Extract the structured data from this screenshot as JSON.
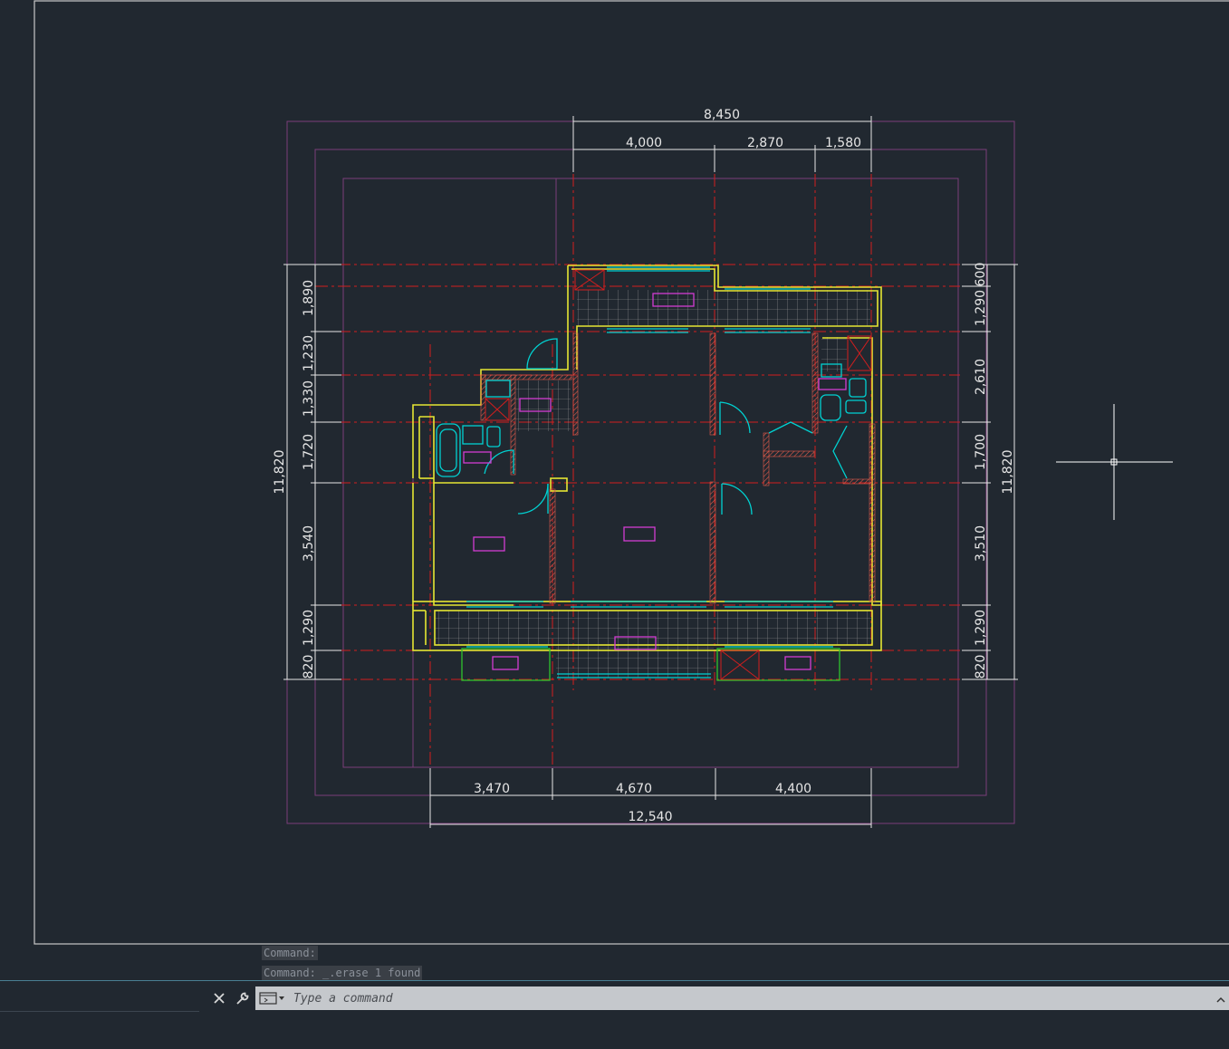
{
  "drawing": {
    "dimensions": {
      "top_total": "8,450",
      "top_segments": [
        "4,000",
        "2,870",
        "1,580"
      ],
      "bottom_segments": [
        "3,470",
        "4,670",
        "4,400"
      ],
      "bottom_total": "12,540",
      "left_segments": [
        "1,890",
        "1,230",
        "1,330",
        "1,720",
        "3,540",
        "1,290",
        "820"
      ],
      "left_total": "11,820",
      "right_segments": [
        "600",
        "1,290",
        "2,610",
        "1,700",
        "3,510",
        "1,290",
        "820"
      ],
      "right_total": "11,820"
    },
    "colors": {
      "background": "#212830",
      "wall_outline": "#e6e632",
      "fixtures": "#00d2d2",
      "axis_lines": "#d21e1e",
      "room_tags": "#d23cd2",
      "frames": "#7a3e7a",
      "balcony_green": "#2ec42e",
      "dimensions": "#e6e6e6"
    }
  },
  "command_line": {
    "history": [
      "Command:",
      "Command: _.erase 1 found"
    ],
    "placeholder": "Type a command",
    "close_icon": "close-icon",
    "customize_icon": "wrench-icon",
    "prompt_icon": "command-prompt-icon",
    "history_toggle_icon": "chevron-up-icon"
  }
}
